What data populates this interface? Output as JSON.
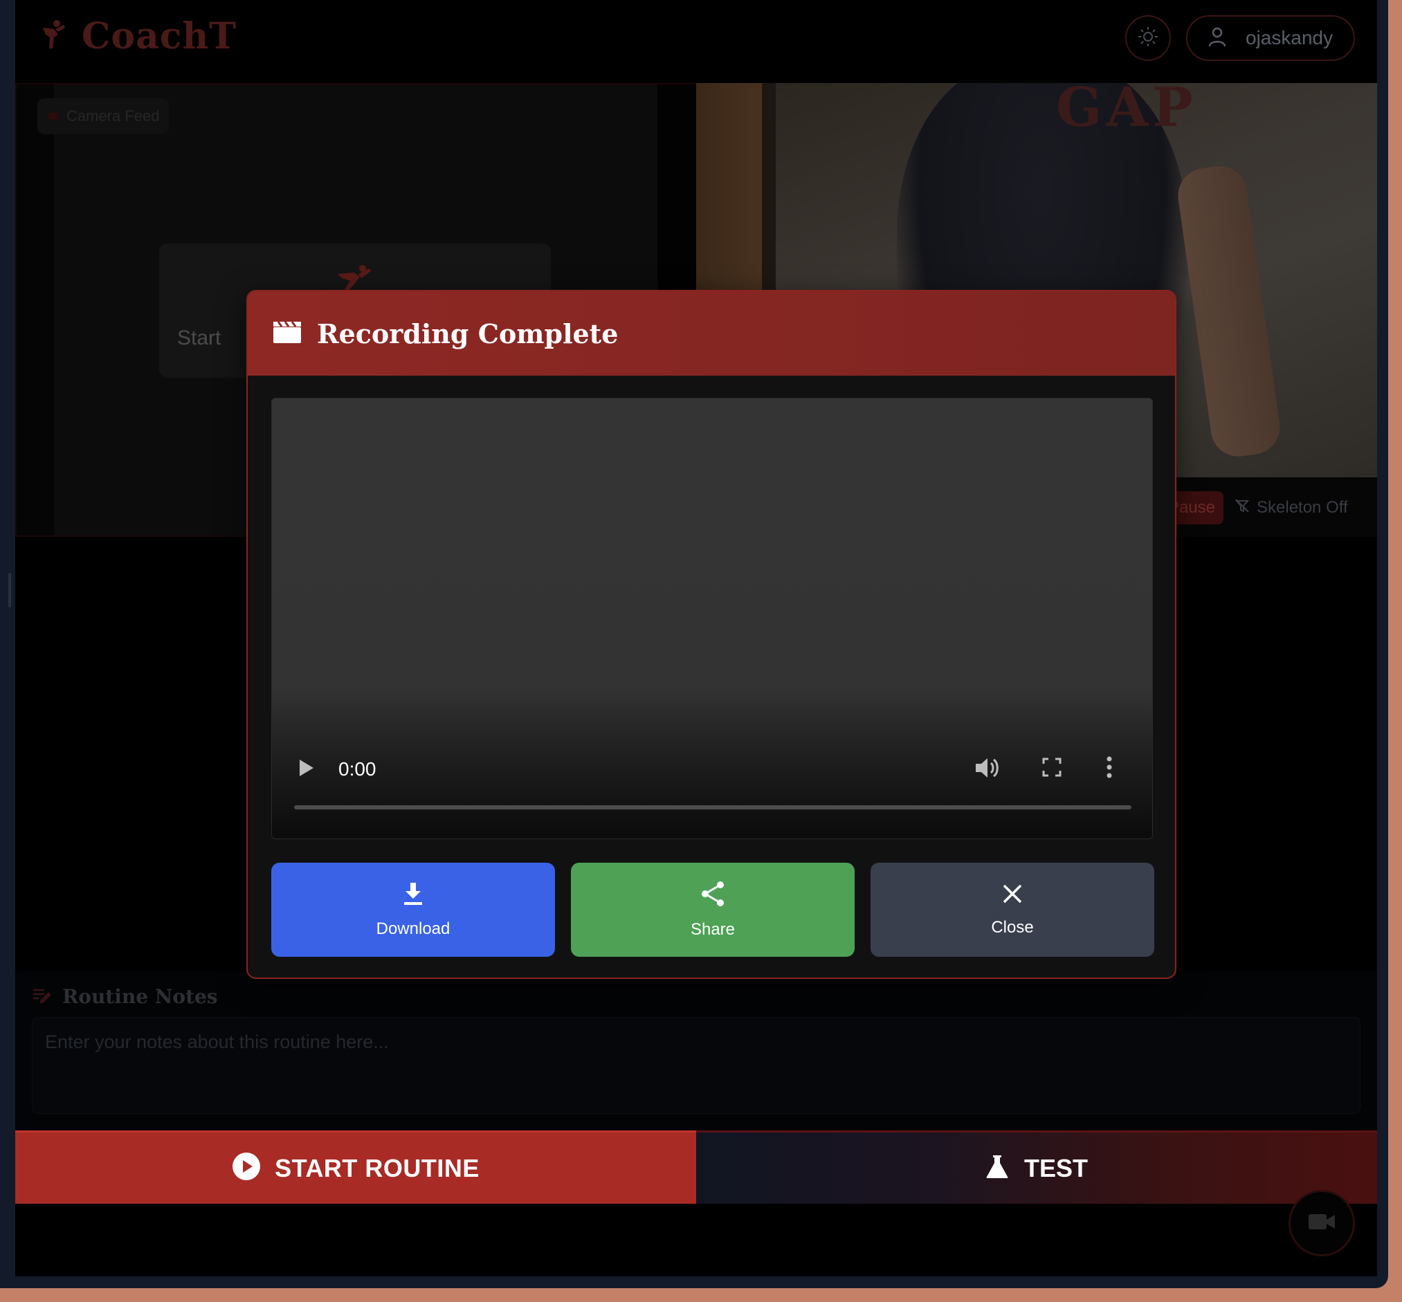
{
  "header": {
    "app_name": "CoachT",
    "username": "ojaskandy",
    "icons": {
      "logo": "martial-arts-kick-icon",
      "theme": "sun-icon",
      "user": "user-icon"
    }
  },
  "camera": {
    "label": "Camera Feed",
    "start_prompt": "Start"
  },
  "right_panel": {
    "shirt_text": "GAP",
    "pause_label": "Pause",
    "skeleton_label": "Skeleton Off"
  },
  "notes": {
    "title": "Routine Notes",
    "placeholder": "Enter your notes about this routine here..."
  },
  "actions": {
    "start_routine_label": "START ROUTINE",
    "test_label": "TEST"
  },
  "modal": {
    "title": "Recording Complete",
    "video": {
      "current_time": "0:00",
      "progress": 0
    },
    "buttons": {
      "download": "Download",
      "share": "Share",
      "close": "Close"
    }
  },
  "colors": {
    "accent_red": "#a82b26",
    "modal_header": "#8e2824",
    "download_blue": "#3962e6",
    "share_green": "#4ea155",
    "close_gray": "#3a3f4e"
  }
}
